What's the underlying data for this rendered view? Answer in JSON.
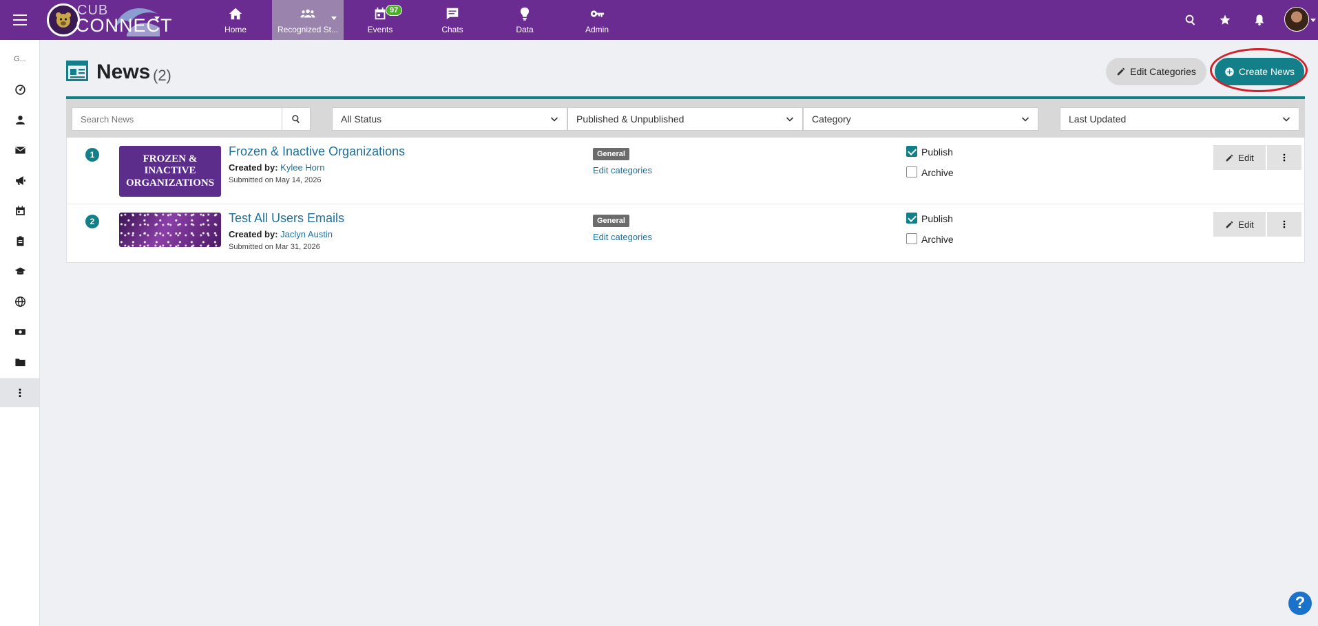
{
  "brand": {
    "logo_text_top": "CUB",
    "logo_text_bottom": "CONNECT",
    "accent": "#6a2c91",
    "teal": "#127f89"
  },
  "topnav": [
    {
      "label": "Home",
      "icon": "home-icon"
    },
    {
      "label": "Recognized St...",
      "icon": "people-icon",
      "active": true
    },
    {
      "label": "Events",
      "icon": "calendar-icon",
      "badge": "97"
    },
    {
      "label": "Chats",
      "icon": "chat-icon"
    },
    {
      "label": "Data",
      "icon": "lightbulb-icon"
    },
    {
      "label": "Admin",
      "icon": "key-icon"
    }
  ],
  "sidebar": {
    "label": "G..."
  },
  "page": {
    "title": "News",
    "count": "(2)"
  },
  "actions": {
    "edit_categories": "Edit Categories",
    "create_news": "Create News"
  },
  "filters": {
    "search_placeholder": "Search News",
    "status": "All Status",
    "published": "Published & Unpublished",
    "category": "Category",
    "sort": "Last Updated"
  },
  "news": [
    {
      "num": "1",
      "thumb_lines": [
        "FROZEN &",
        "INACTIVE",
        "ORGANIZATIONS"
      ],
      "title": "Frozen & Inactive Organizations",
      "created_label": "Created by:",
      "author": "Kylee Horn",
      "submitted": "Submitted on May 14, 2026",
      "category": "General",
      "edit_categories": "Edit categories",
      "publish_label": "Publish",
      "archive_label": "Archive",
      "published": true,
      "archived": false,
      "edit_label": "Edit"
    },
    {
      "num": "2",
      "title": "Test All Users Emails",
      "created_label": "Created by:",
      "author": "Jaclyn Austin",
      "submitted": "Submitted on Mar 31, 2026",
      "category": "General",
      "edit_categories": "Edit categories",
      "publish_label": "Publish",
      "archive_label": "Archive",
      "published": true,
      "archived": false,
      "edit_label": "Edit"
    }
  ],
  "help": "?"
}
